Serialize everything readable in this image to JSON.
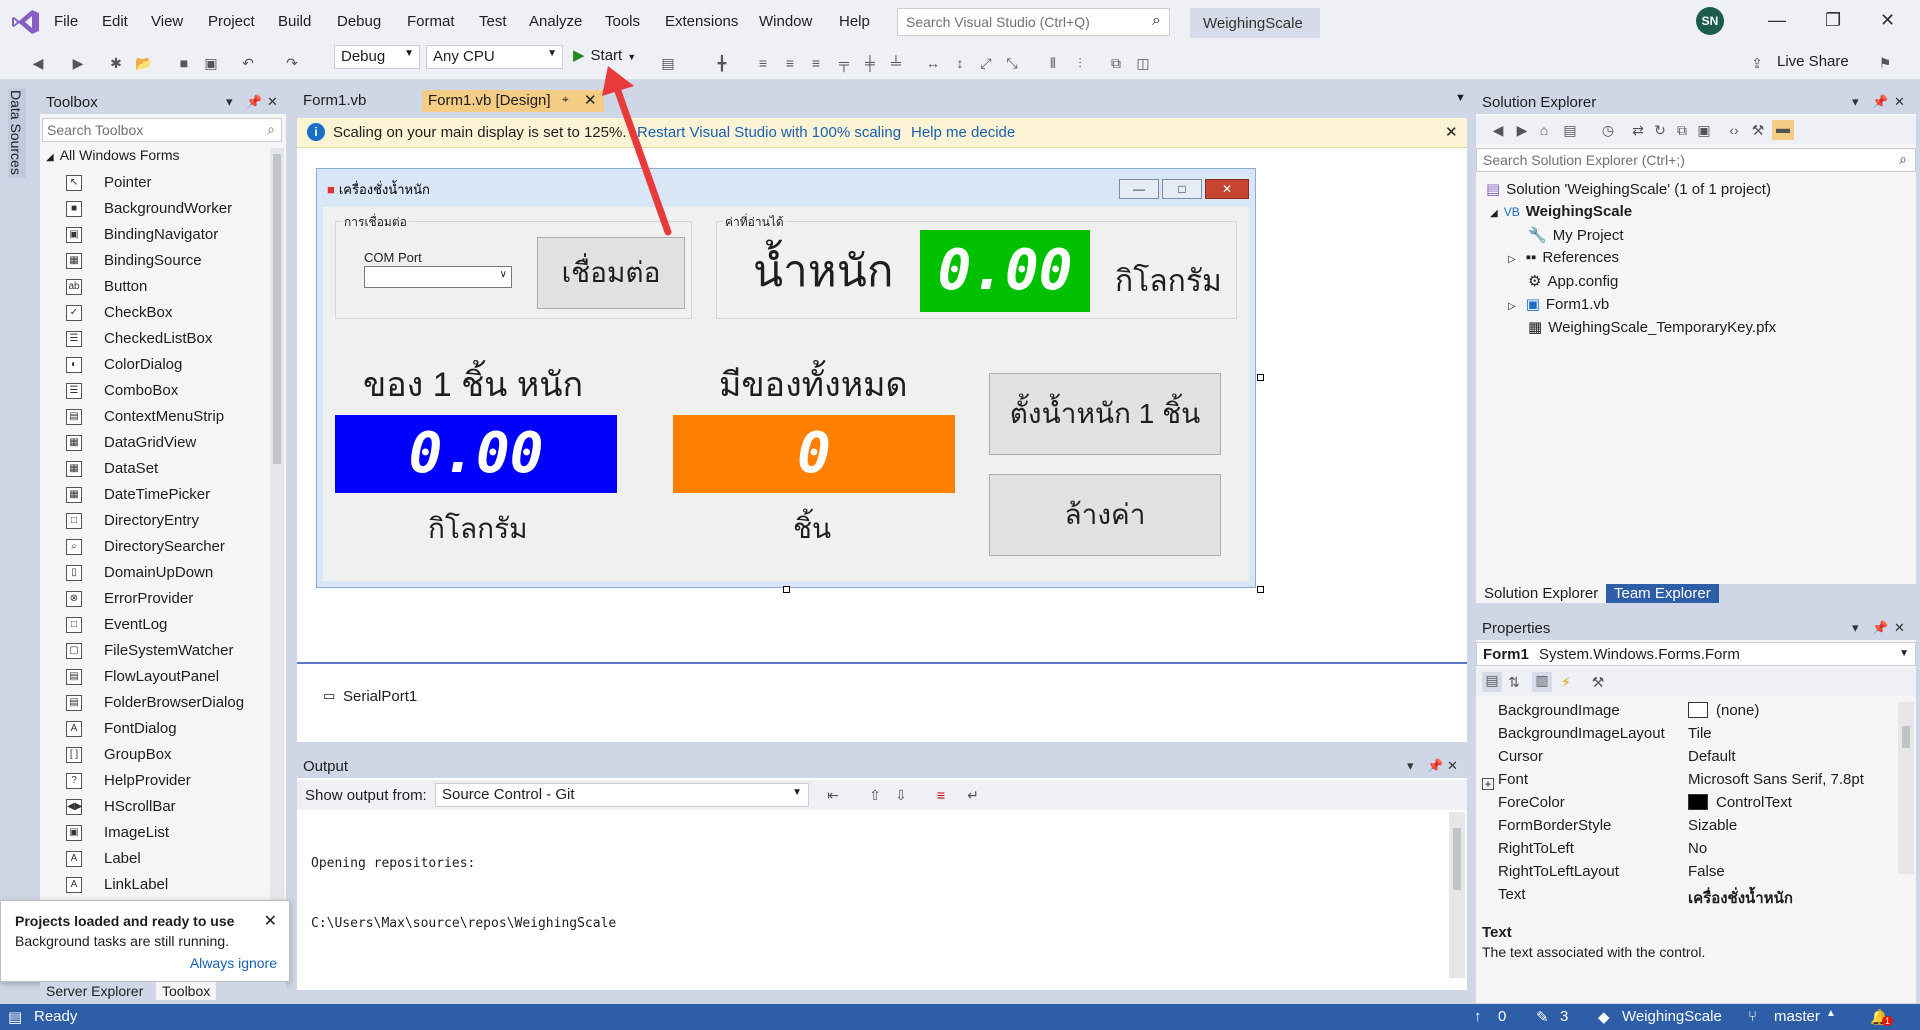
{
  "menu": [
    "File",
    "Edit",
    "View",
    "Project",
    "Build",
    "Debug",
    "Format",
    "Test",
    "Analyze",
    "Tools",
    "Extensions",
    "Window",
    "Help"
  ],
  "search": {
    "placeholder": "Search Visual Studio (Ctrl+Q)"
  },
  "project_name": "WeighingScale",
  "avatar": "SN",
  "toolbar": {
    "config": "Debug",
    "platform": "Any CPU",
    "start": "Start",
    "live_share": "Live Share"
  },
  "left_strip": {
    "data_sources": "Data Sources"
  },
  "toolbox": {
    "title": "Toolbox",
    "search_placeholder": "Search Toolbox",
    "group": "All Windows Forms",
    "items": [
      "Pointer",
      "BackgroundWorker",
      "BindingNavigator",
      "BindingSource",
      "Button",
      "CheckBox",
      "CheckedListBox",
      "ColorDialog",
      "ComboBox",
      "ContextMenuStrip",
      "DataGridView",
      "DataSet",
      "DateTimePicker",
      "DirectoryEntry",
      "DirectorySearcher",
      "DomainUpDown",
      "ErrorProvider",
      "EventLog",
      "FileSystemWatcher",
      "FlowLayoutPanel",
      "FolderBrowserDialog",
      "FontDialog",
      "GroupBox",
      "HelpProvider",
      "HScrollBar",
      "ImageList",
      "Label",
      "LinkLabel"
    ]
  },
  "tabs": {
    "form1": "Form1.vb",
    "design": "Form1.vb [Design]"
  },
  "infobar": {
    "message": "Scaling on your main display is set to 125%.",
    "restart": "Restart Visual Studio with 100% scaling",
    "help": "Help me decide"
  },
  "form": {
    "title": "เครื่องชั่งน้ำหนัก",
    "group_connect": "การเชื่อมต่อ",
    "com_port_label": "COM Port",
    "connect_button": "เชื่อมต่อ",
    "group_reading": "ค่าที่อ่านได้",
    "weight_label": "น้ำหนัก",
    "weight_value": "0.00",
    "kg_label": "กิโลกรัม",
    "unit_weight_label": "ของ 1 ชิ้น หนัก",
    "unit_weight_value": "0.00",
    "unit_kg_label": "กิโลกรัม",
    "total_label": "มีของทั้งหมด",
    "total_value": "0",
    "pieces_label": "ชิ้น",
    "set_weight_button": "ตั้งน้ำหนัก 1 ชิ้น",
    "clear_button": "ล้างค่า"
  },
  "tray": {
    "serial": "SerialPort1"
  },
  "output": {
    "title": "Output",
    "show_from_label": "Show output from:",
    "source": "Source Control - Git",
    "lines": [
      "Opening repositories:",
      "C:\\Users\\Max\\source\\repos\\WeighingScale"
    ]
  },
  "solution_explorer": {
    "title": "Solution Explorer",
    "search_placeholder": "Search Solution Explorer (Ctrl+;)",
    "solution": "Solution 'WeighingScale' (1 of 1 project)",
    "project": "WeighingScale",
    "items": [
      "My Project",
      "References",
      "App.config",
      "Form1.vb",
      "WeighingScale_TemporaryKey.pfx"
    ],
    "tab_solution": "Solution Explorer",
    "tab_team": "Team Explorer"
  },
  "properties": {
    "title": "Properties",
    "object": "Form1",
    "object_type": "System.Windows.Forms.Form",
    "rows": [
      {
        "name": "BackgroundImage",
        "value": "(none)"
      },
      {
        "name": "BackgroundImageLayout",
        "value": "Tile"
      },
      {
        "name": "Cursor",
        "value": "Default"
      },
      {
        "name": "Font",
        "value": "Microsoft Sans Serif, 7.8pt"
      },
      {
        "name": "ForeColor",
        "value": "ControlText"
      },
      {
        "name": "FormBorderStyle",
        "value": "Sizable"
      },
      {
        "name": "RightToLeft",
        "value": "No"
      },
      {
        "name": "RightToLeftLayout",
        "value": "False"
      },
      {
        "name": "Text",
        "value": "เครื่องชั่งน้ำหนัก"
      }
    ],
    "desc_title": "Text",
    "desc_text": "The text associated with the control."
  },
  "toast": {
    "title": "Projects loaded and ready to use",
    "subtitle": "Background tasks are still running.",
    "action": "Always ignore"
  },
  "bottom_tabs": {
    "server": "Server Explorer",
    "toolbox": "Toolbox"
  },
  "status": {
    "ready": "Ready",
    "up": "0",
    "pencil": "3",
    "repo": "WeighingScale",
    "branch": "master",
    "notif": "1"
  },
  "colors": {
    "accent": "#2e5ea8",
    "weight_bg": "#00c000",
    "unit_bg": "#0000ff",
    "total_bg": "#ff8000",
    "arrow": "#e83a3a"
  }
}
